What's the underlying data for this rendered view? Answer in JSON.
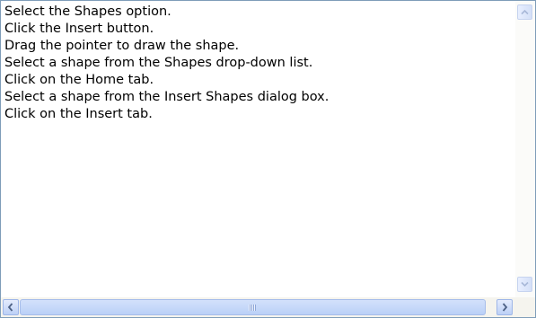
{
  "lines": [
    "Select the Shapes option.",
    "Click the Insert button.",
    "Drag the pointer to draw the shape.",
    "Select a shape from the Shapes drop-down list.",
    "Click on the Home tab.",
    "Select a shape from the Insert Shapes dialog box.",
    "Click on the Insert tab."
  ],
  "icons": {
    "scroll_up": "chevron-up-icon",
    "scroll_down": "chevron-down-icon",
    "scroll_left": "chevron-left-icon",
    "scroll_right": "chevron-right-icon"
  },
  "colors": {
    "border": "#7f9db9",
    "scroll_accent": "#bad0f7",
    "arrow": "#4d6185"
  }
}
